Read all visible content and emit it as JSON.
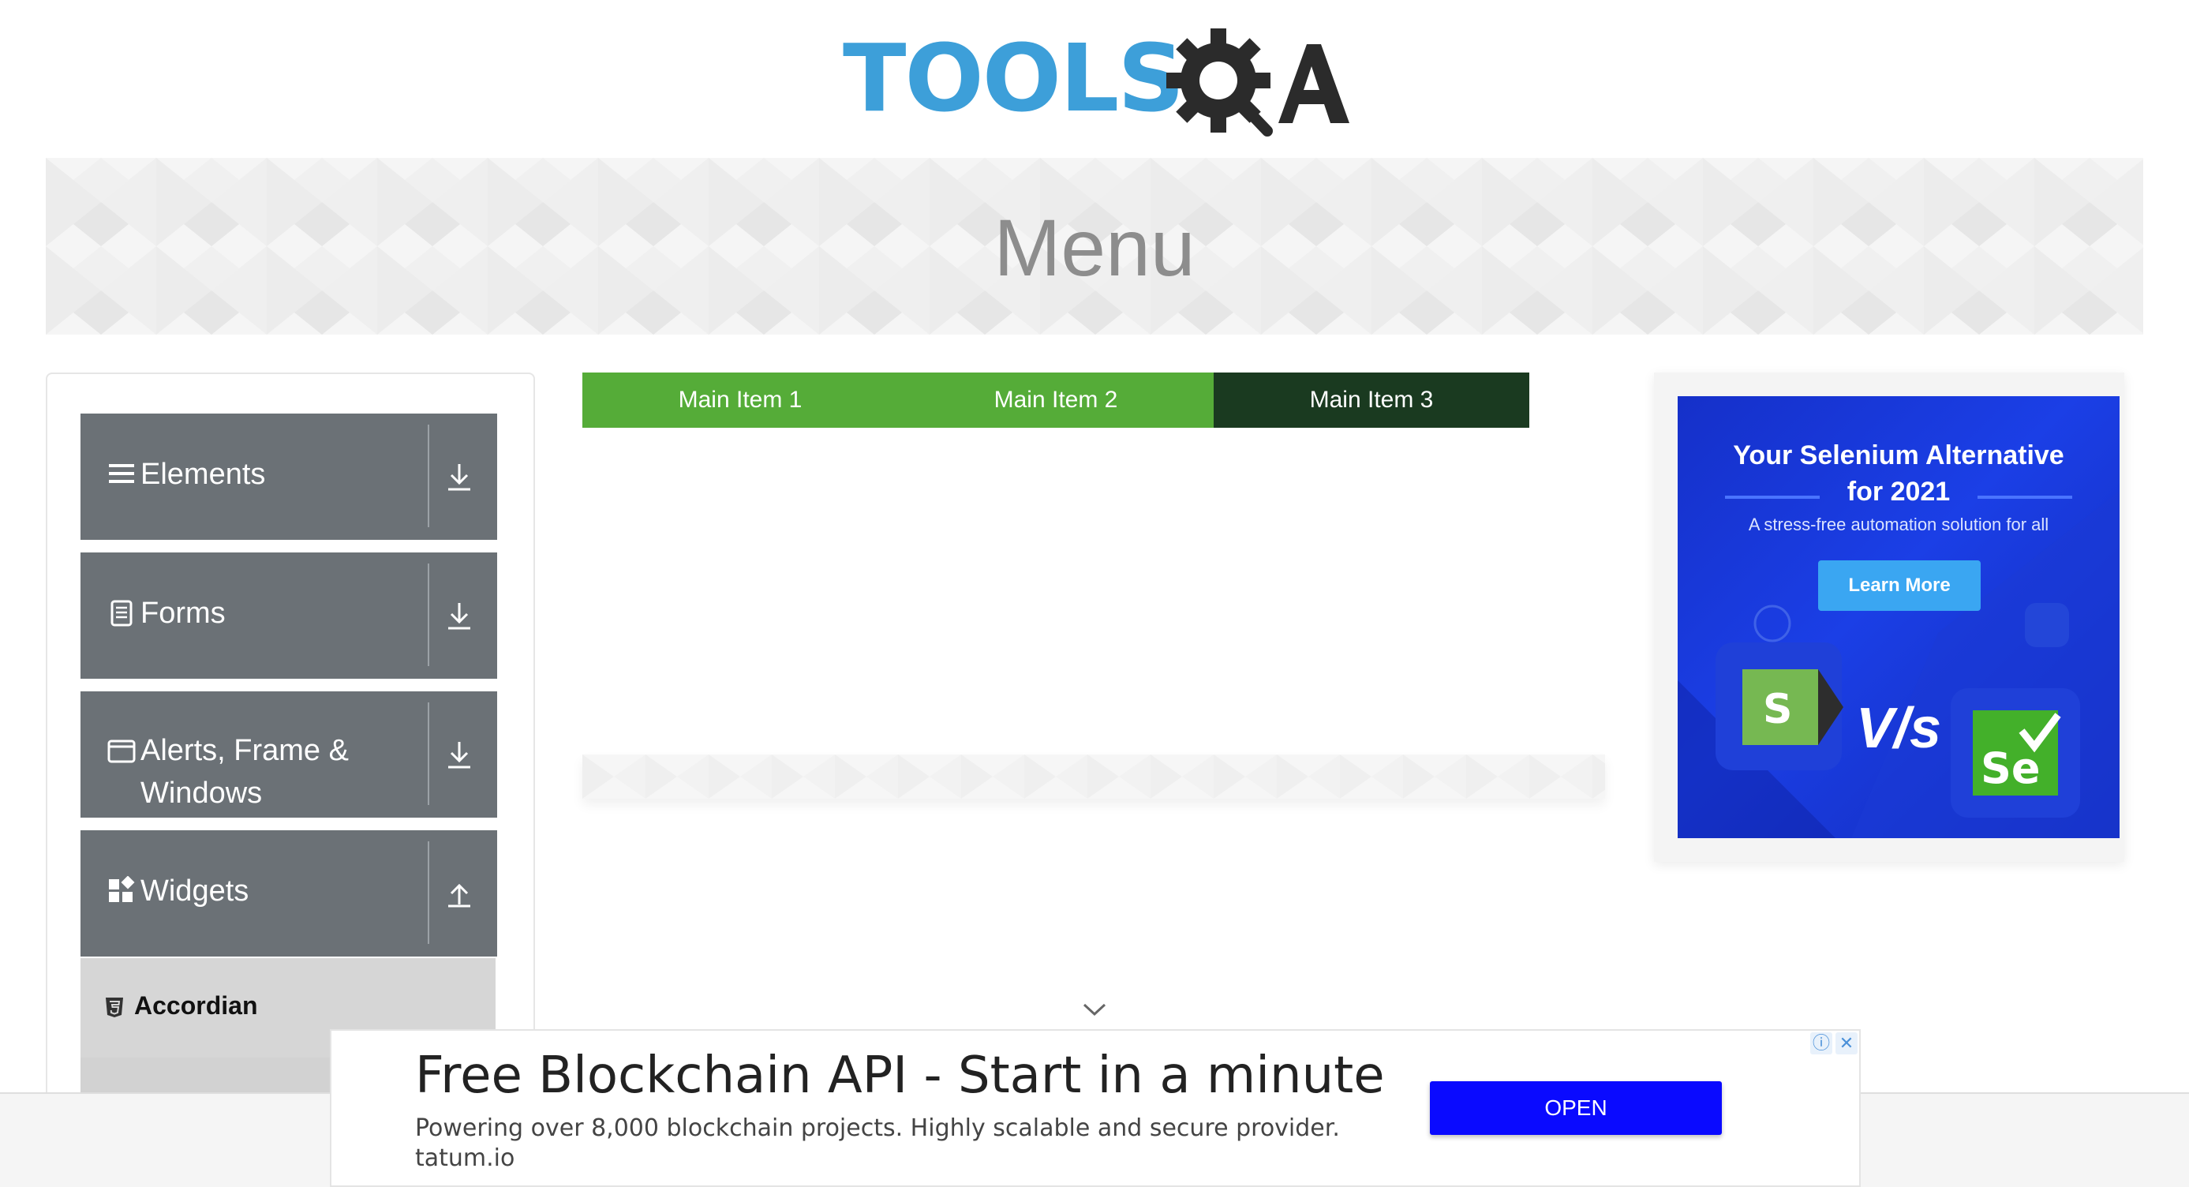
{
  "logo": {
    "text": "TOOLS",
    "suffix": "A",
    "icon": "gear-search-icon"
  },
  "banner": {
    "title": "Menu"
  },
  "sidebar": {
    "groups": [
      {
        "label": "Elements",
        "icon": "hamburger-icon",
        "arrow": "download-arrow-icon"
      },
      {
        "label": "Forms",
        "icon": "document-icon",
        "arrow": "download-arrow-icon"
      },
      {
        "label": "Alerts, Frame &\nWindows",
        "label_line1": "Alerts, Frame &",
        "label_line2": "Windows",
        "icon": "window-icon",
        "arrow": "download-arrow-icon"
      },
      {
        "label": "Widgets",
        "icon": "widgets-icon",
        "arrow": "upload-arrow-icon"
      }
    ],
    "sub_items": [
      {
        "label": "Accordian",
        "icon": "html5-icon"
      }
    ]
  },
  "nav": {
    "items": [
      {
        "label": "Main Item 1"
      },
      {
        "label": "Main Item 2"
      },
      {
        "label": "Main Item 3"
      }
    ],
    "colors": {
      "green": "#55ac38",
      "dark": "#1a3a20"
    }
  },
  "ad_right": {
    "headline": "Your Selenium Alternative for 2021",
    "headline_line1": "Your Selenium Alternative",
    "headline_line2": "for 2021",
    "subtext": "A stress-free automation solution for all",
    "cta": "Learn More",
    "vs_text": "V/s",
    "left_logo": "S",
    "right_logo": "Se"
  },
  "ad_bottom": {
    "title": "Free Blockchain API - Start in a minute",
    "subtitle": "Powering over 8,000 blockchain projects. Highly scalable and secure provider.",
    "url": "tatum.io",
    "button": "OPEN",
    "info_icon": "info-icon",
    "close_icon": "close-icon"
  }
}
